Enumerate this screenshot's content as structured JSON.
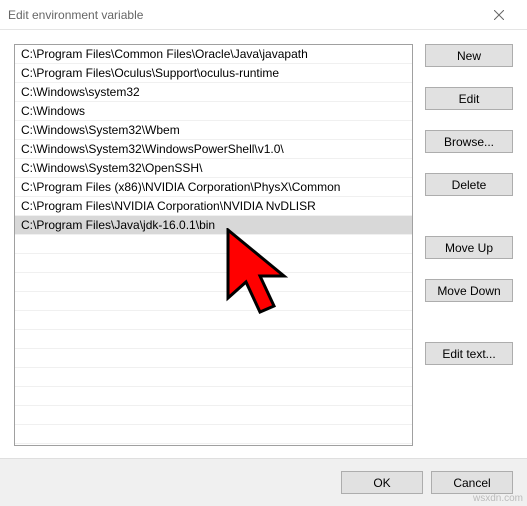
{
  "window": {
    "title": "Edit environment variable"
  },
  "paths": [
    "C:\\Program Files\\Common Files\\Oracle\\Java\\javapath",
    "C:\\Program Files\\Oculus\\Support\\oculus-runtime",
    "C:\\Windows\\system32",
    "C:\\Windows",
    "C:\\Windows\\System32\\Wbem",
    "C:\\Windows\\System32\\WindowsPowerShell\\v1.0\\",
    "C:\\Windows\\System32\\OpenSSH\\",
    "C:\\Program Files (x86)\\NVIDIA Corporation\\PhysX\\Common",
    "C:\\Program Files\\NVIDIA Corporation\\NVIDIA NvDLISR",
    "C:\\Program Files\\Java\\jdk-16.0.1\\bin"
  ],
  "selected_index": 9,
  "buttons": {
    "new": "New",
    "edit": "Edit",
    "browse": "Browse...",
    "delete": "Delete",
    "move_up": "Move Up",
    "move_down": "Move Down",
    "edit_text": "Edit text...",
    "ok": "OK",
    "cancel": "Cancel"
  },
  "watermark": "wsxdn.com"
}
